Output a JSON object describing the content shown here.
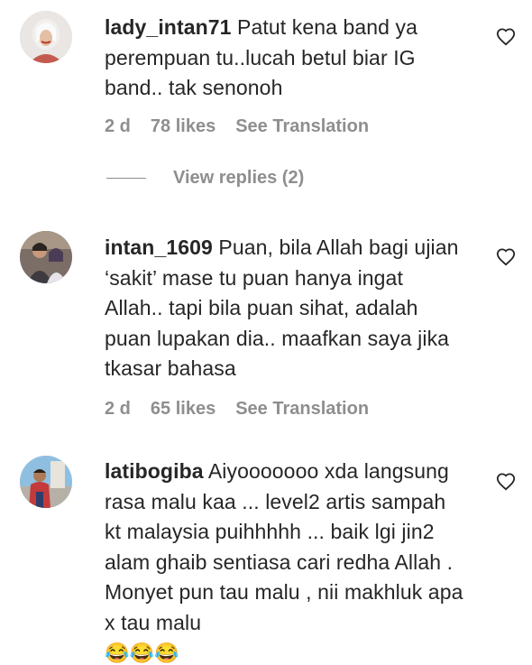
{
  "comments": [
    {
      "username": "lady_intan71",
      "text": "Patut kena band ya perempuan tu..lucah betul biar IG band.. tak senonoh",
      "time": "2 d",
      "likes": "78 likes",
      "translate": "See Translation"
    },
    {
      "username": "intan_1609",
      "text": "Puan, bila Allah bagi ujian ‘sakit’ mase tu puan hanya ingat Allah.. tapi bila puan sihat, adalah puan lupakan dia.. maafkan saya jika tkasar bahasa",
      "time": "2 d",
      "likes": "65 likes",
      "translate": "See Translation"
    },
    {
      "username": "latibogiba",
      "text": "Aiyooooooo xda langsung rasa malu kaa ... level2 artis sampah kt malaysia puihhhhh ... baik lgi jin2 alam ghaib sentiasa cari redha Allah . Monyet pun tau malu , nii makhluk apa x tau malu",
      "emojis": "😂😂😂"
    }
  ],
  "view_replies": "View replies (2)",
  "icons": {
    "like": "heart-outline-icon"
  },
  "colors": {
    "text": "#262626",
    "secondary": "#8e8e8e"
  }
}
